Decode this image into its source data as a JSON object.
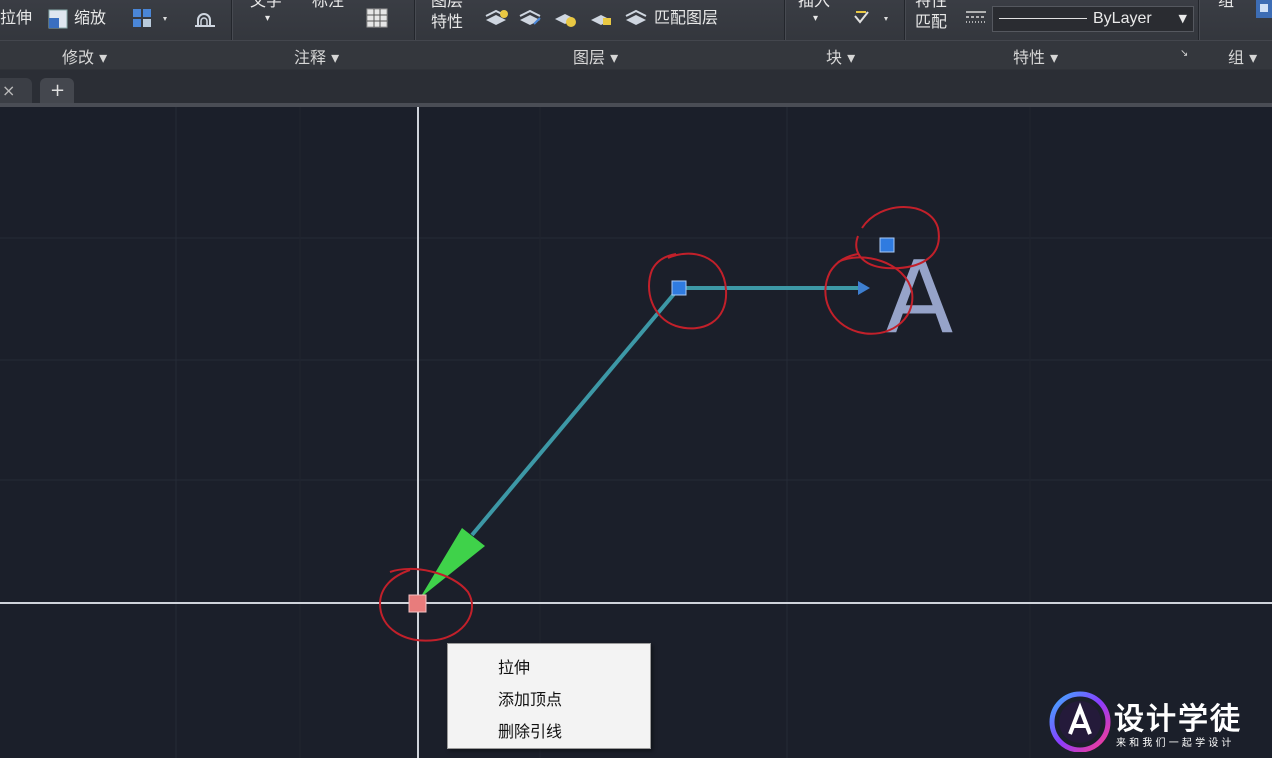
{
  "ribbon": {
    "modify": {
      "stretch": "拉伸",
      "scale": "缩放",
      "group_label": "修改"
    },
    "annotation": {
      "text": "文字",
      "dimension": "标注",
      "group_label": "注释"
    },
    "layers": {
      "layer_properties_line1": "图层",
      "layer_properties_line2": "特性",
      "match_layer": "匹配图层",
      "group_label": "图层"
    },
    "block": {
      "insert": "插入",
      "group_label": "块"
    },
    "properties": {
      "match_line1": "特性",
      "match_line2": "匹配",
      "linetype_value": "ByLayer",
      "group_label": "特性"
    },
    "groups": {
      "group": "组",
      "group_label": "组"
    }
  },
  "tabs": {
    "new_tab": "+",
    "close": "×"
  },
  "canvas": {
    "mtext": "A"
  },
  "context_menu": {
    "items": [
      "拉伸",
      "添加顶点",
      "删除引线"
    ]
  },
  "watermark": {
    "brand": "设计学徒",
    "tagline": "来 和 我 们 一 起 学 设 计"
  }
}
